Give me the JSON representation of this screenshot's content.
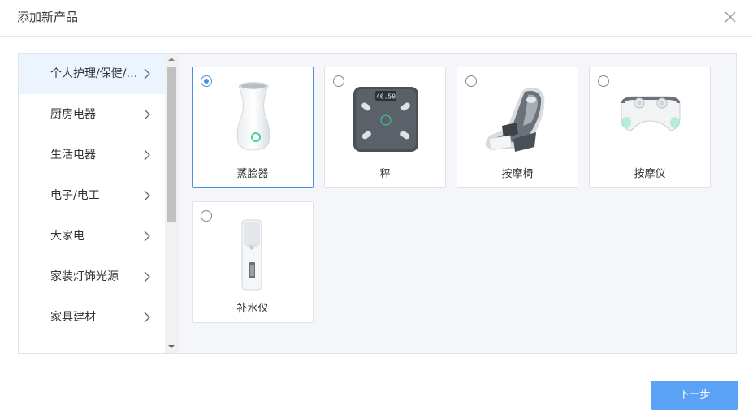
{
  "dialog": {
    "title": "添加新产品",
    "next_label": "下一步"
  },
  "categories": [
    {
      "label": "个人护理/保健/…",
      "active": true
    },
    {
      "label": "厨房电器"
    },
    {
      "label": "生活电器"
    },
    {
      "label": "电子/电工"
    },
    {
      "label": "大家电"
    },
    {
      "label": "家装灯饰光源"
    },
    {
      "label": "家具建材"
    }
  ],
  "products": [
    {
      "name": "蒸脸器",
      "selected": true,
      "icon": "facial-steamer-icon"
    },
    {
      "name": "秤",
      "selected": false,
      "icon": "bathroom-scale-icon",
      "display": "46.50"
    },
    {
      "name": "按摩椅",
      "selected": false,
      "icon": "massage-chair-icon"
    },
    {
      "name": "按摩仪",
      "selected": false,
      "icon": "neck-massager-icon"
    },
    {
      "name": "补水仪",
      "selected": false,
      "icon": "nano-mist-sprayer-icon"
    }
  ],
  "colors": {
    "accent": "#4a90e2",
    "button": "#5aa2f5",
    "active_bg": "#ecf5ff"
  }
}
